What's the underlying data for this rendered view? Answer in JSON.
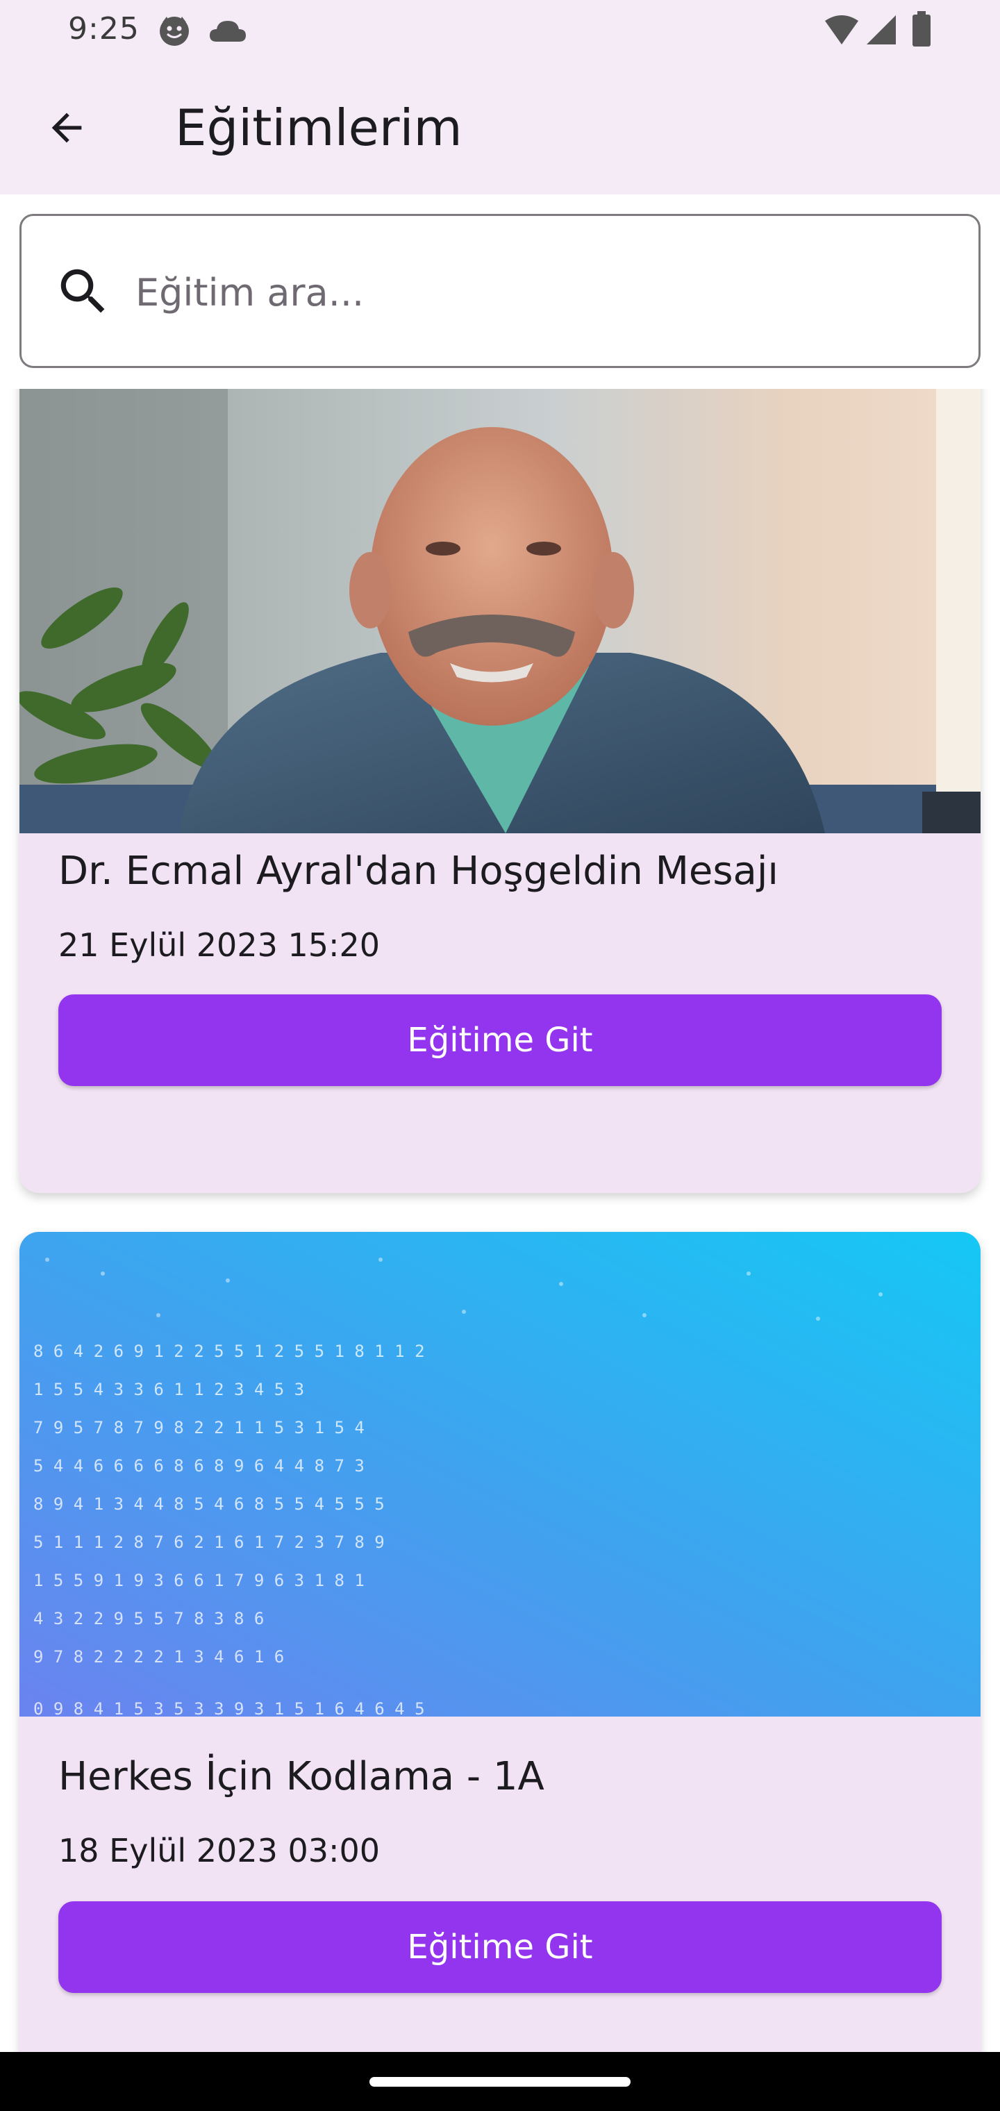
{
  "status_bar": {
    "time": "9:25",
    "icons": [
      "smiley-notification-icon",
      "cloud-icon",
      "wifi-icon",
      "cellular-signal-icon",
      "battery-icon"
    ]
  },
  "app_bar": {
    "title": "Eğitimlerim",
    "back_icon": "arrow-back-icon"
  },
  "search": {
    "placeholder": "Eğitim ara...",
    "value": "",
    "icon": "search-icon"
  },
  "trainings": [
    {
      "title": "Dr. Ecmal Ayral'dan Hoşgeldin Mesajı",
      "date": "21 Eylül 2023 15:20",
      "button_label": "Eğitime Git",
      "thumbnail": "presenter-video-thumbnail"
    },
    {
      "title": "Herkes İçin Kodlama - 1A",
      "date": "18 Eylül 2023 03:00",
      "button_label": "Eğitime Git",
      "thumbnail": "digital-numbers-thumbnail"
    }
  ],
  "colors": {
    "app_bar_bg": "#f4ebf6",
    "card_bg": "#f1e3f4",
    "button_bg": "#9334ef",
    "button_text": "#ffffff"
  }
}
